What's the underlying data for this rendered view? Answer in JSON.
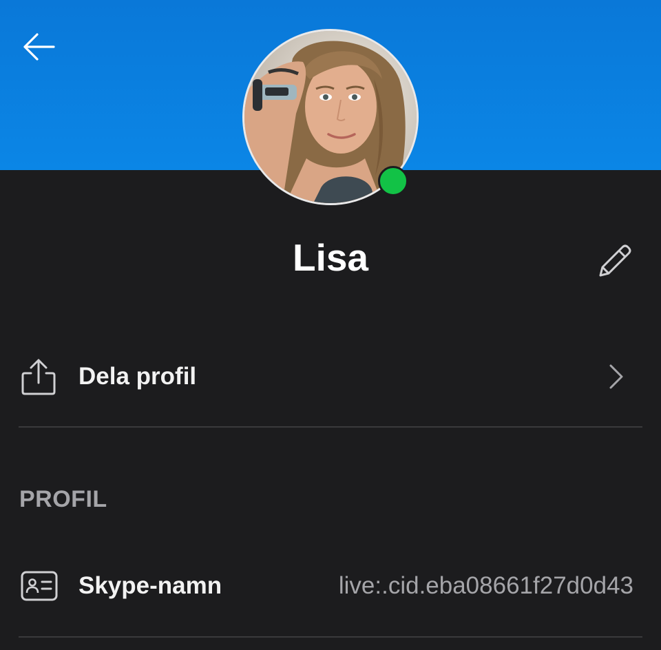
{
  "profile": {
    "name": "Lisa",
    "presence": "online"
  },
  "header": {
    "back_icon": "arrow-left-icon",
    "edit_icon": "pencil-icon"
  },
  "share": {
    "label": "Dela profil",
    "icon": "share-icon",
    "chevron_icon": "chevron-right-icon"
  },
  "section": {
    "title": "PROFIL"
  },
  "fields": [
    {
      "label": "Skype-namn",
      "value": "live:.cid.eba08661f27d0d43",
      "icon": "id-card-icon"
    }
  ],
  "colors": {
    "header_blue": "#0b86e6",
    "background": "#1c1c1e",
    "presence_green": "#12c246",
    "divider": "#3a3a3c",
    "secondary_text": "#a5a5a9"
  }
}
